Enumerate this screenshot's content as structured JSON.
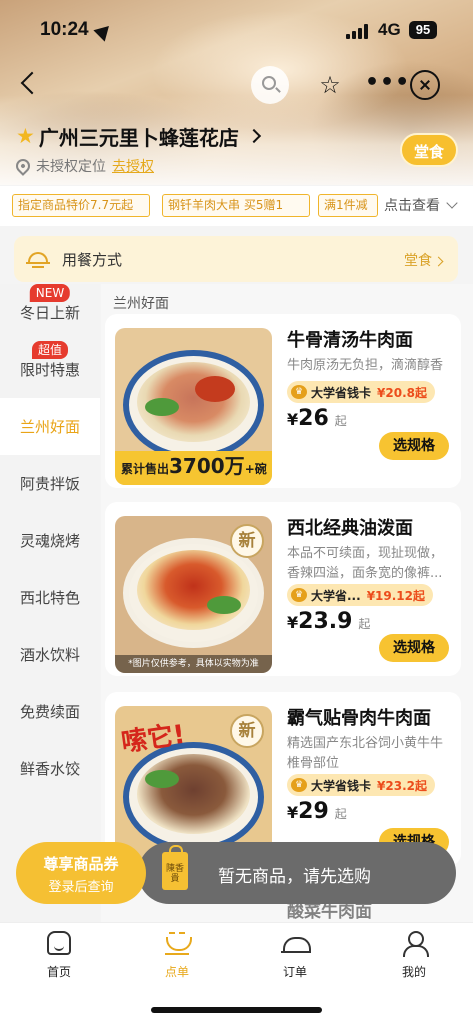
{
  "status_bar": {
    "time": "10:24",
    "network": "4G",
    "battery": "95"
  },
  "header": {
    "store_name": "广州三元里卜蜂莲花店",
    "location_status": "未授权定位",
    "authorize_link": "去授权",
    "dine_mode_badge": "堂食"
  },
  "promos": {
    "tags": [
      "指定商品特价7.7元起",
      "钢钎羊肉大串 买5赠1",
      "满1件减"
    ],
    "view_more": "点击查看"
  },
  "dining": {
    "label": "用餐方式",
    "value": "堂食"
  },
  "sidebar": {
    "items": [
      {
        "label": "冬日上新",
        "badge": "NEW"
      },
      {
        "label": "限时特惠",
        "badge": "超值"
      },
      {
        "label": "兰州好面",
        "badge": ""
      },
      {
        "label": "阿贵拌饭",
        "badge": ""
      },
      {
        "label": "灵魂烧烤",
        "badge": ""
      },
      {
        "label": "西北特色",
        "badge": ""
      },
      {
        "label": "酒水饮料",
        "badge": ""
      },
      {
        "label": "免费续面",
        "badge": ""
      },
      {
        "label": "鲜香水饺",
        "badge": ""
      }
    ],
    "active_index": 2
  },
  "menu": {
    "section_title": "兰州好面",
    "products": [
      {
        "name": "牛骨清汤牛肉面",
        "desc": "牛肉原汤无负担，滴滴醇香",
        "card_label": "大学省钱卡",
        "card_price": "¥20.8起",
        "currency": "¥",
        "price": "26",
        "price_suffix": "起",
        "button": "选规格",
        "image_caption_prefix": "累计售出",
        "image_caption_number": "3700万",
        "image_caption_suffix": "+碗"
      },
      {
        "name": "西北经典油泼面",
        "desc": "本品不可续面，现扯现做，香辣四溢，面条宽的像裤...",
        "card_label": "大学省...",
        "card_price": "¥19.12起",
        "currency": "¥",
        "price": "23.9",
        "price_suffix": "起",
        "button": "选规格",
        "image_badge": "新",
        "image_note": "*图片仅供参考，具体以实物为准"
      },
      {
        "name": "霸气贴骨肉牛肉面",
        "desc": "精选国产东北谷饲小黄牛牛椎骨部位",
        "card_label": "大学省钱卡",
        "card_price": "¥23.2起",
        "currency": "¥",
        "price": "29",
        "price_suffix": "起",
        "button": "选规格",
        "image_badge": "新",
        "image_title": "嗦它!"
      }
    ],
    "peek_next": "酸菜牛肉面"
  },
  "cart": {
    "coupon_title": "尊享商品券",
    "coupon_subtitle": "登录后查询",
    "empty_message": "暂无商品，请先选购"
  },
  "tabbar": {
    "items": [
      "首页",
      "点单",
      "订单",
      "我的"
    ],
    "active_index": 1
  },
  "colors": {
    "accent": "#f5c033",
    "price_red": "#ec4d1c",
    "active_text": "#e9a417"
  }
}
